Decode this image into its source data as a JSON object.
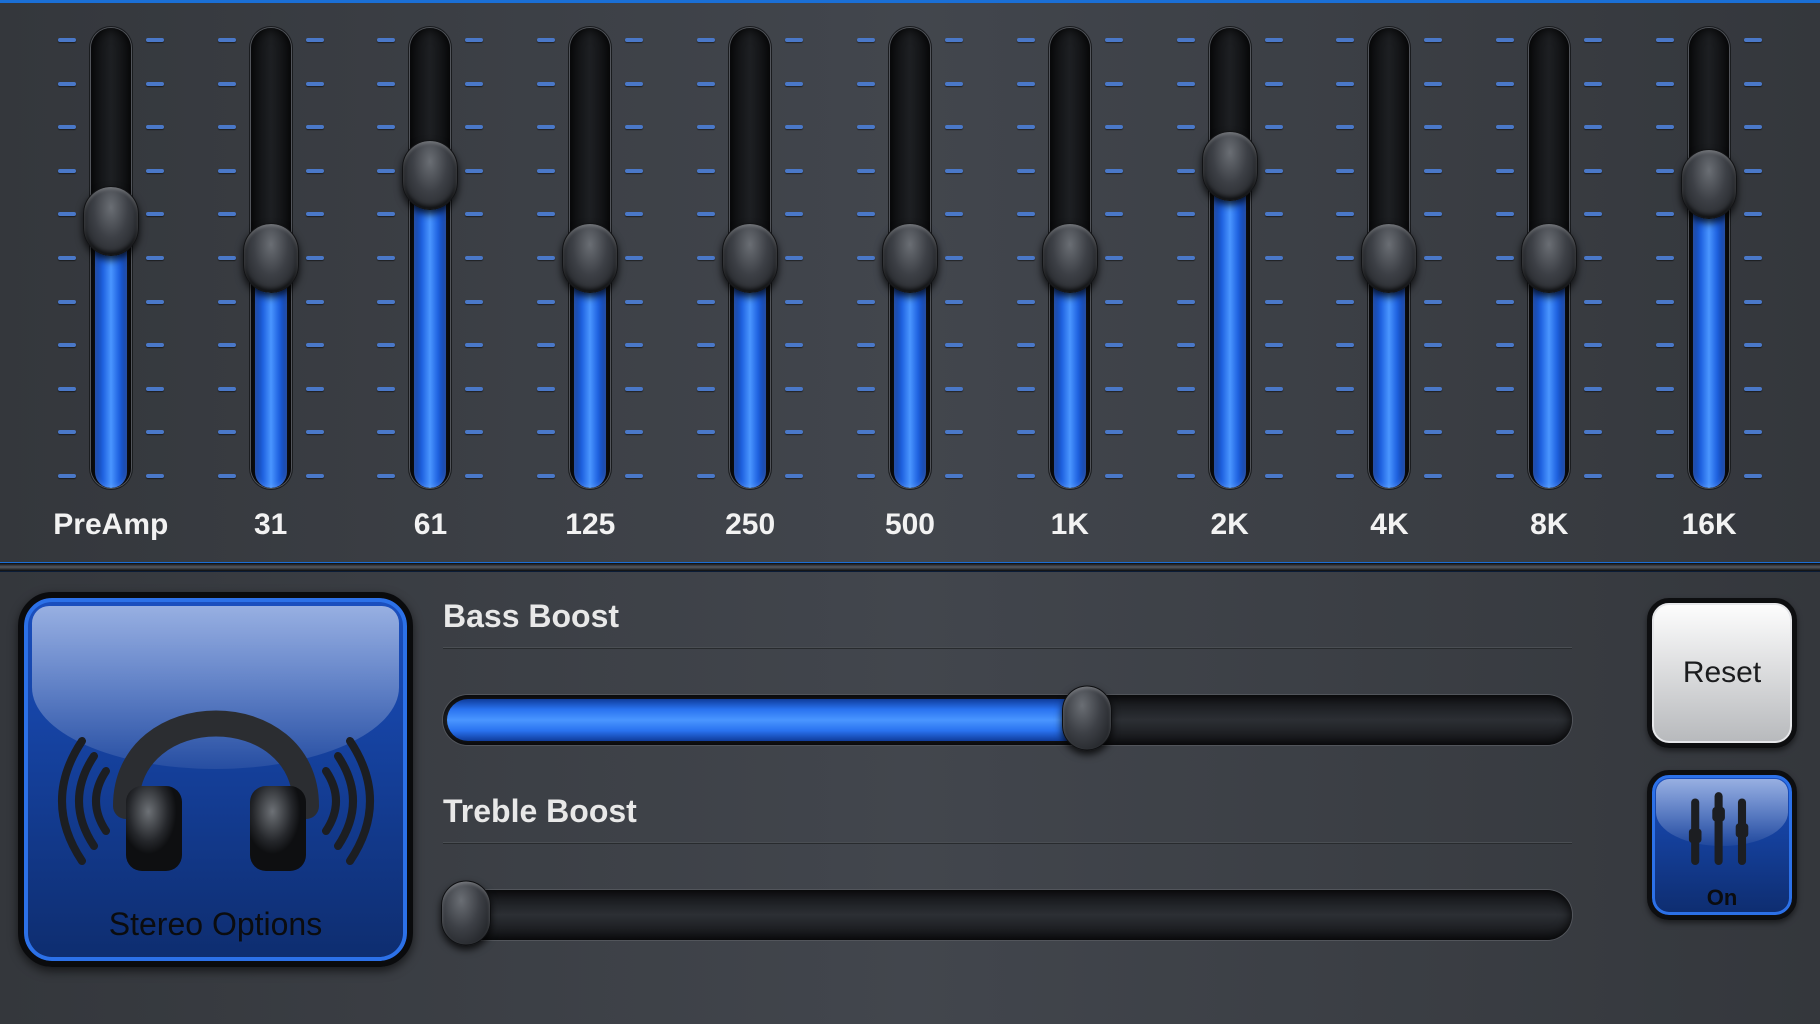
{
  "eq": {
    "bands": [
      {
        "label": "PreAmp",
        "value": 58
      },
      {
        "label": "31",
        "value": 50
      },
      {
        "label": "61",
        "value": 68
      },
      {
        "label": "125",
        "value": 50
      },
      {
        "label": "250",
        "value": 50
      },
      {
        "label": "500",
        "value": 50
      },
      {
        "label": "1K",
        "value": 50
      },
      {
        "label": "2K",
        "value": 70
      },
      {
        "label": "4K",
        "value": 50
      },
      {
        "label": "8K",
        "value": 50
      },
      {
        "label": "16K",
        "value": 66
      }
    ]
  },
  "stereo": {
    "label": "Stereo Options"
  },
  "boosts": {
    "bass": {
      "label": "Bass Boost",
      "value": 57
    },
    "treble": {
      "label": "Treble Boost",
      "value": 2
    }
  },
  "controls": {
    "reset": "Reset",
    "eq_toggle": "On"
  },
  "colors": {
    "accent": "#2a73f0"
  }
}
